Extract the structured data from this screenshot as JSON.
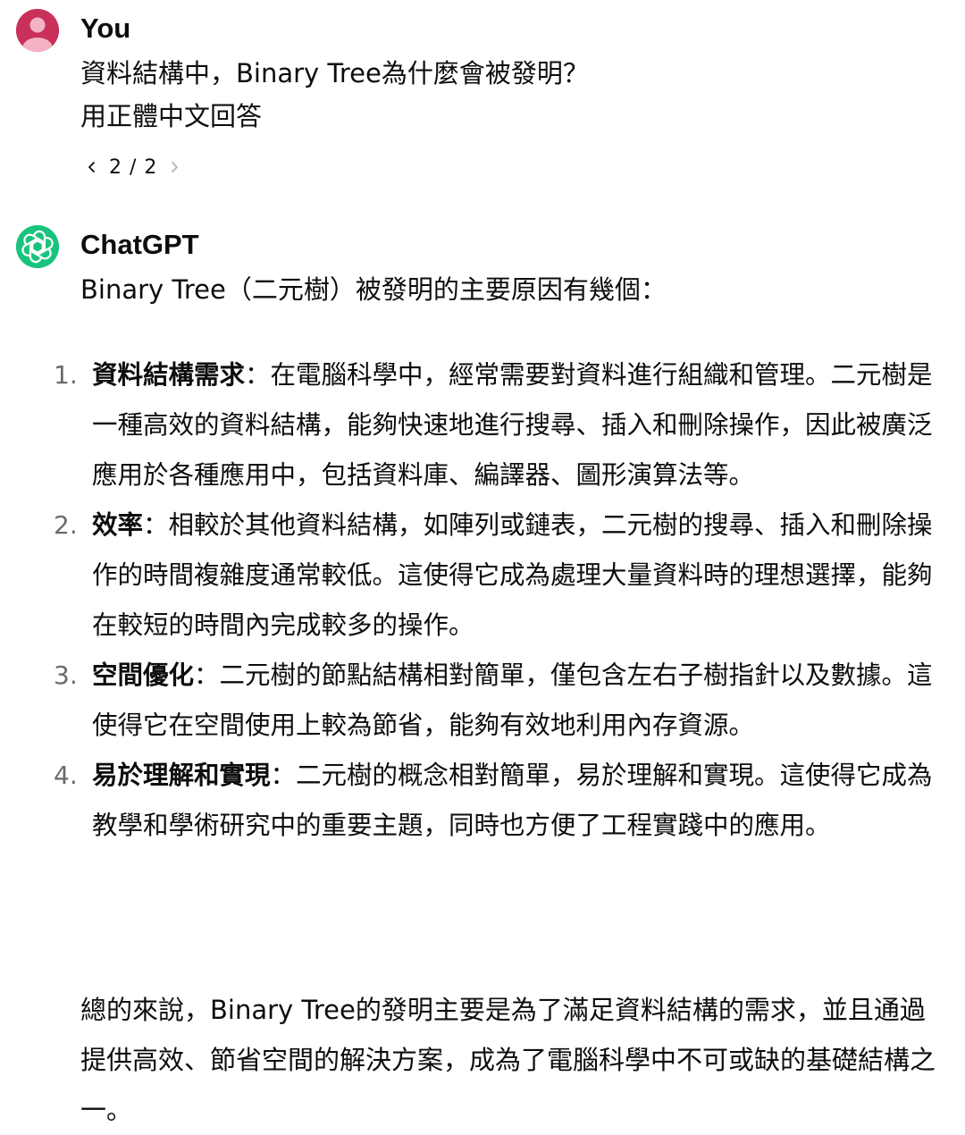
{
  "user": {
    "name": "You",
    "lines": [
      "資料結構中，Binary Tree為什麼會被發明？",
      "用正體中文回答"
    ],
    "pager": "2 / 2"
  },
  "assistant": {
    "name": "ChatGPT",
    "intro": "Binary Tree（二元樹）被發明的主要原因有幾個：",
    "items": [
      {
        "num": "1.",
        "title": "資料結構需求",
        "text": "：在電腦科學中，經常需要對資料進行組織和管理。二元樹是一種高效的資料結構，能夠快速地進行搜尋、插入和刪除操作，因此被廣泛應用於各種應用中，包括資料庫、編譯器、圖形演算法等。"
      },
      {
        "num": "2.",
        "title": "效率",
        "text": "：相較於其他資料結構，如陣列或鏈表，二元樹的搜尋、插入和刪除操作的時間複雜度通常較低。這使得它成為處理大量資料時的理想選擇，能夠在較短的時間內完成較多的操作。"
      },
      {
        "num": "3.",
        "title": "空間優化",
        "text": "：二元樹的節點結構相對簡單，僅包含左右子樹指針以及數據。這使得它在空間使用上較為節省，能夠有效地利用內存資源。"
      },
      {
        "num": "4.",
        "title": "易於理解和實現",
        "text": "：二元樹的概念相對簡單，易於理解和實現。這使得它成為教學和學術研究中的重要主題，同時也方便了工程實踐中的應用。"
      }
    ],
    "summary": "總的來說，Binary Tree的發明主要是為了滿足資料結構的需求，並且通過提供高效、節省空間的解決方案，成為了電腦科學中不可或缺的基礎結構之一。"
  },
  "icons": {
    "user_avatar": "user-avatar-icon",
    "assistant_avatar": "openai-logo-icon",
    "prev": "chevron-left-icon",
    "next": "chevron-right-icon"
  },
  "colors": {
    "user_avatar_bg": "#c9305a",
    "assistant_avatar_bg": "#19c37d",
    "text": "#0d0d0d",
    "muted": "#6b6b6b"
  }
}
